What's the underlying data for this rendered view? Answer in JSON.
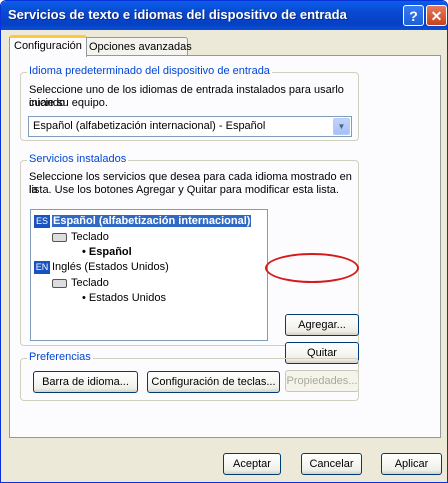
{
  "window": {
    "title": "Servicios de texto e idiomas del dispositivo de entrada"
  },
  "tabs": [
    {
      "label": "Configuración"
    },
    {
      "label": "Opciones avanzadas"
    }
  ],
  "default_group": {
    "label": "Idioma predeterminado del dispositivo de entrada",
    "desc1": "Seleccione uno de los idiomas de entrada instalados para usarlo cuando",
    "desc2": "inicie su equipo.",
    "combo_value": "Español (alfabetización internacional) - Español"
  },
  "installed_group": {
    "label": "Servicios instalados",
    "desc1": "Seleccione los servicios que desea para cada idioma mostrado en la",
    "desc2": "lista. Use los botones Agregar y Quitar para modificar esta lista.",
    "tree": {
      "lang1": {
        "code": "ES",
        "name": "Español (alfabetización internacional)"
      },
      "lang1_keyboard": "Teclado",
      "lang1_layout": "• Español",
      "lang2": {
        "code": "EN",
        "name": "Inglés (Estados Unidos)"
      },
      "lang2_keyboard": "Teclado",
      "lang2_layout": "• Estados Unidos"
    },
    "add_button": "Agregar...",
    "remove_button": "Quitar",
    "properties_button": "Propiedades..."
  },
  "prefs_group": {
    "label": "Preferencias",
    "language_bar_button": "Barra de idioma...",
    "key_settings_button": "Configuración de teclas..."
  },
  "footer": {
    "ok": "Aceptar",
    "cancel": "Cancelar",
    "apply": "Aplicar"
  },
  "colors": {
    "highlight_circle": "#d41a1a",
    "selection": "#316ac5",
    "group_label": "#0046d5"
  }
}
